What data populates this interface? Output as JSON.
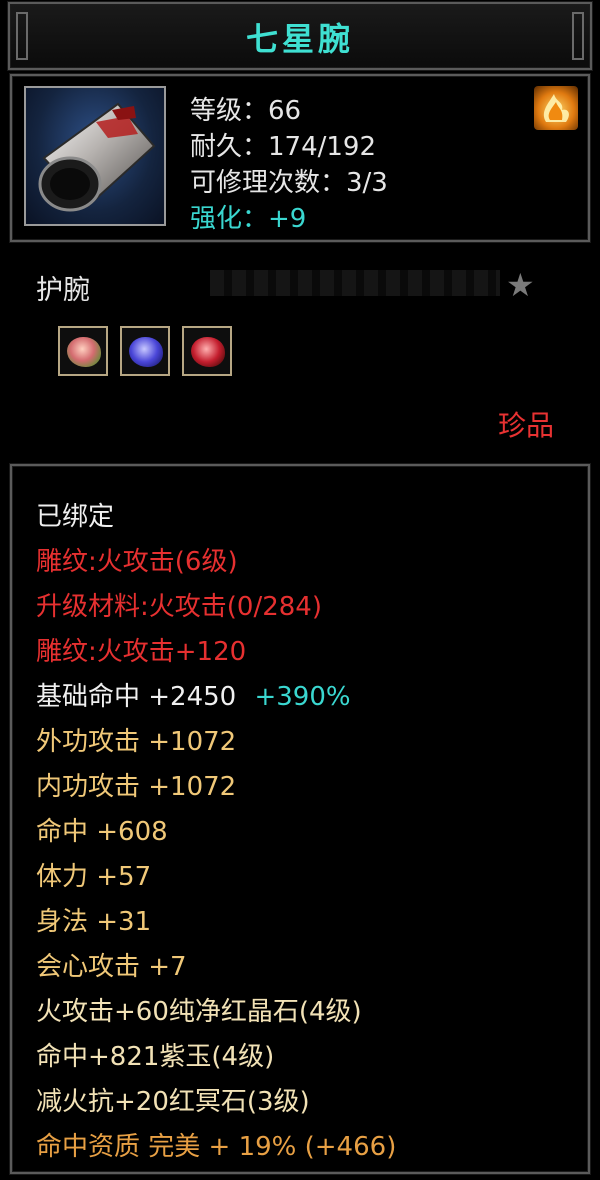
{
  "title": "七星腕",
  "header": {
    "level": "等级：66",
    "durability": "耐久：174/192",
    "repair_count": "可修理次数：3/3",
    "enhance": "强化：+9"
  },
  "item_type": "护腕",
  "quality": "珍品",
  "stats": [
    {
      "text": "已绑定"
    },
    {
      "text": "雕纹:火攻击(6级)"
    },
    {
      "text": "升级材料:火攻击(0/284)"
    },
    {
      "text": "雕纹:火攻击+120"
    },
    {
      "text": "基础命中 +2450",
      "extra": "+390%"
    },
    {
      "text": "外功攻击 +1072"
    },
    {
      "text": "内功攻击 +1072"
    },
    {
      "text": "命中 +608"
    },
    {
      "text": "体力 +57"
    },
    {
      "text": "身法 +31"
    },
    {
      "text": "会心攻击 +7"
    },
    {
      "text": "火攻击+60纯净红晶石(4级)"
    },
    {
      "text": "命中+821紫玉(4级)"
    },
    {
      "text": "减火抗+20红冥石(3级)"
    },
    {
      "text": "命中资质 完美 + 19% (+466)"
    }
  ],
  "colors": {
    "title": "#3fe0d2",
    "cyan": "#3ad7d0",
    "red": "#e63030",
    "gold": "#f0c878",
    "quality": "#e83232"
  },
  "icons": {
    "item": "bracer-icon",
    "corner": "fire-icon",
    "favorite": "star-icon",
    "gems": [
      "red-gem-icon",
      "purple-jade-icon",
      "red-stone-icon"
    ]
  }
}
